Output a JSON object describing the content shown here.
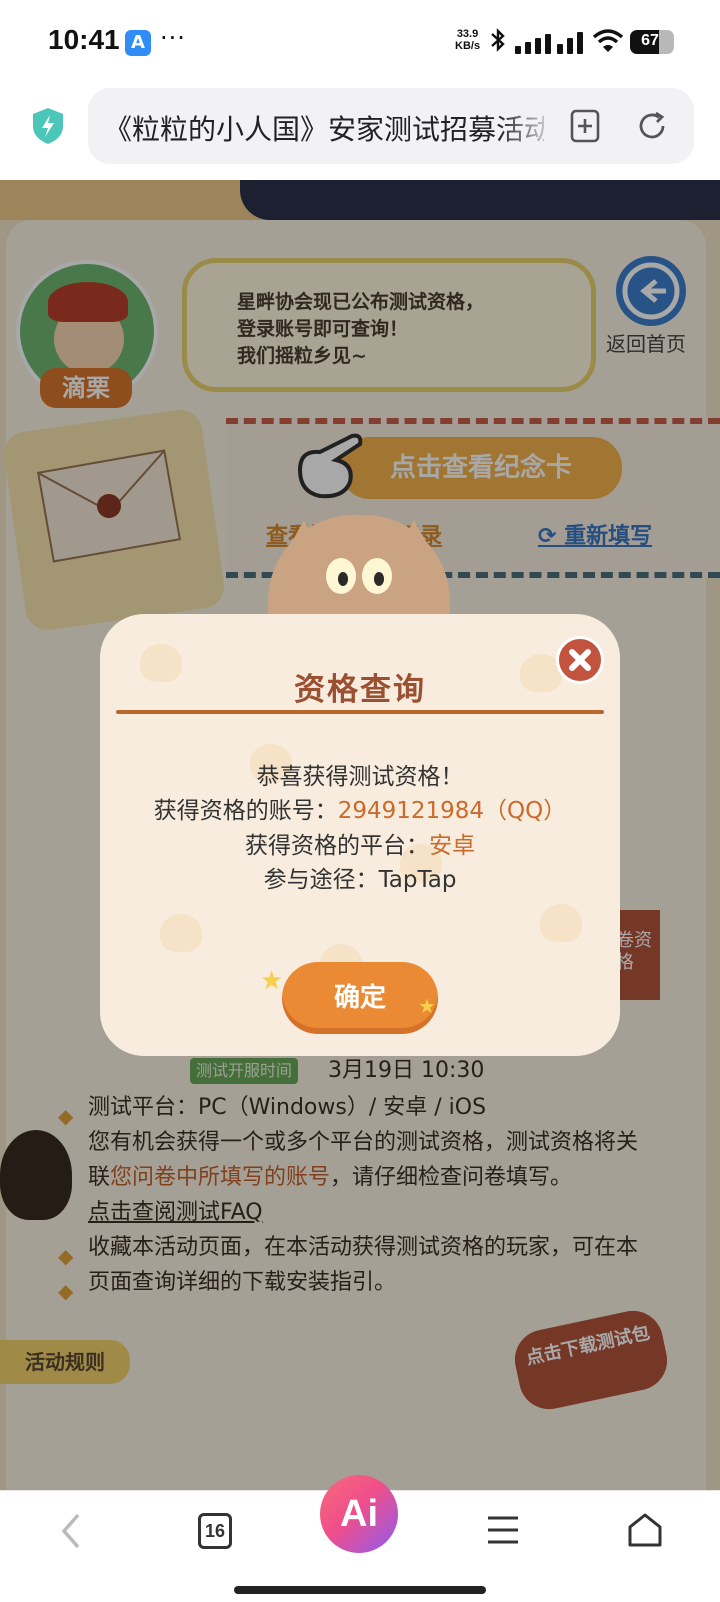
{
  "status_bar": {
    "time": "10:41",
    "appstore_glyph": "A",
    "more": "···",
    "net_speed_value": "33.9",
    "net_speed_unit": "KB/s",
    "battery": "67",
    "battery_level": 0.67
  },
  "address_bar": {
    "title": "《粒粒的小人国》安家测试招募活动"
  },
  "page": {
    "speaker_name": "滴栗",
    "speech": "星畔协会现已公布测试资格，\n登录账号即可查询！\n我们摇粒乡见~",
    "home_label": "返回首页",
    "memorial_button": "点击查看纪念卡",
    "view_record_link": "查看问卷填写记录",
    "refill_link": "重新填写",
    "release_tag": "测试开服时间",
    "release_time": "3月19日  10:30",
    "platform_line": "测试平台：PC（Windows）/ 安卓 / iOS",
    "notice_prefix": "您有机会获得一个或多个平台的测试资格，测试资格将关联",
    "notice_highlight": "您问卷中所填写的账号",
    "notice_suffix": "，请仔细检查问卷填写。",
    "faq_link": "点击查阅测试FAQ",
    "favorite_tip": "收藏本活动页面，在本活动获得测试资格的玩家，可在本页面查询详细的下载安装指引。",
    "rules_button": "活动规则",
    "download_button": "点击下载测试包",
    "side_button": "问卷资格"
  },
  "modal": {
    "title": "资格查询",
    "congrats": "恭喜获得测试资格！",
    "account_label": "获得资格的账号：",
    "account_value": "2949121984（QQ）",
    "platform_label": "获得资格的平台：",
    "platform_value": "安卓",
    "channel_label": "参与途径：",
    "channel_value": "TapTap",
    "confirm": "确定"
  },
  "toolbar": {
    "tabs_count": "16",
    "ai_label": "Ai"
  },
  "colors": {
    "accent_orange": "#eb8a35",
    "title_brown": "#9b5031",
    "highlight": "#cc6a2a"
  }
}
